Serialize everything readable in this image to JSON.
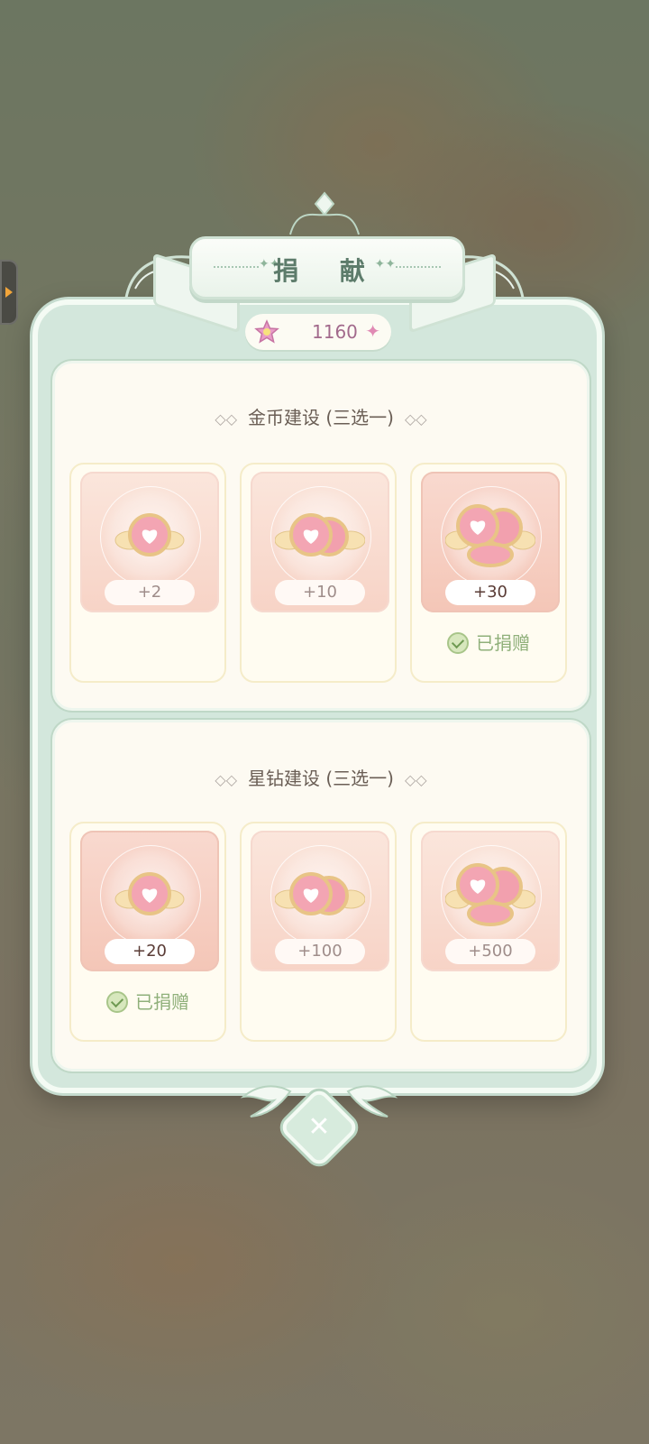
{
  "dialog": {
    "title": "捐 献"
  },
  "currency": {
    "value": "1160",
    "icon": "pink-star-icon",
    "add_icon": "plus-sparkle-icon"
  },
  "sections": [
    {
      "title": "金币建设 (三选一)",
      "items": [
        {
          "amount": "+2",
          "donated": false
        },
        {
          "amount": "+10",
          "donated": false
        },
        {
          "amount": "+30",
          "donated": true,
          "donated_label": "已捐赠"
        }
      ]
    },
    {
      "title": "星钻建设 (三选一)",
      "items": [
        {
          "amount": "+20",
          "donated": true,
          "donated_label": "已捐赠"
        },
        {
          "amount": "+100",
          "donated": false
        },
        {
          "amount": "+500",
          "donated": false
        }
      ]
    }
  ],
  "colors": {
    "panel": "#d3e7dc",
    "card": "#f7d3c6",
    "accent_pink": "#e58aa6",
    "check_green": "#8fb07a"
  }
}
